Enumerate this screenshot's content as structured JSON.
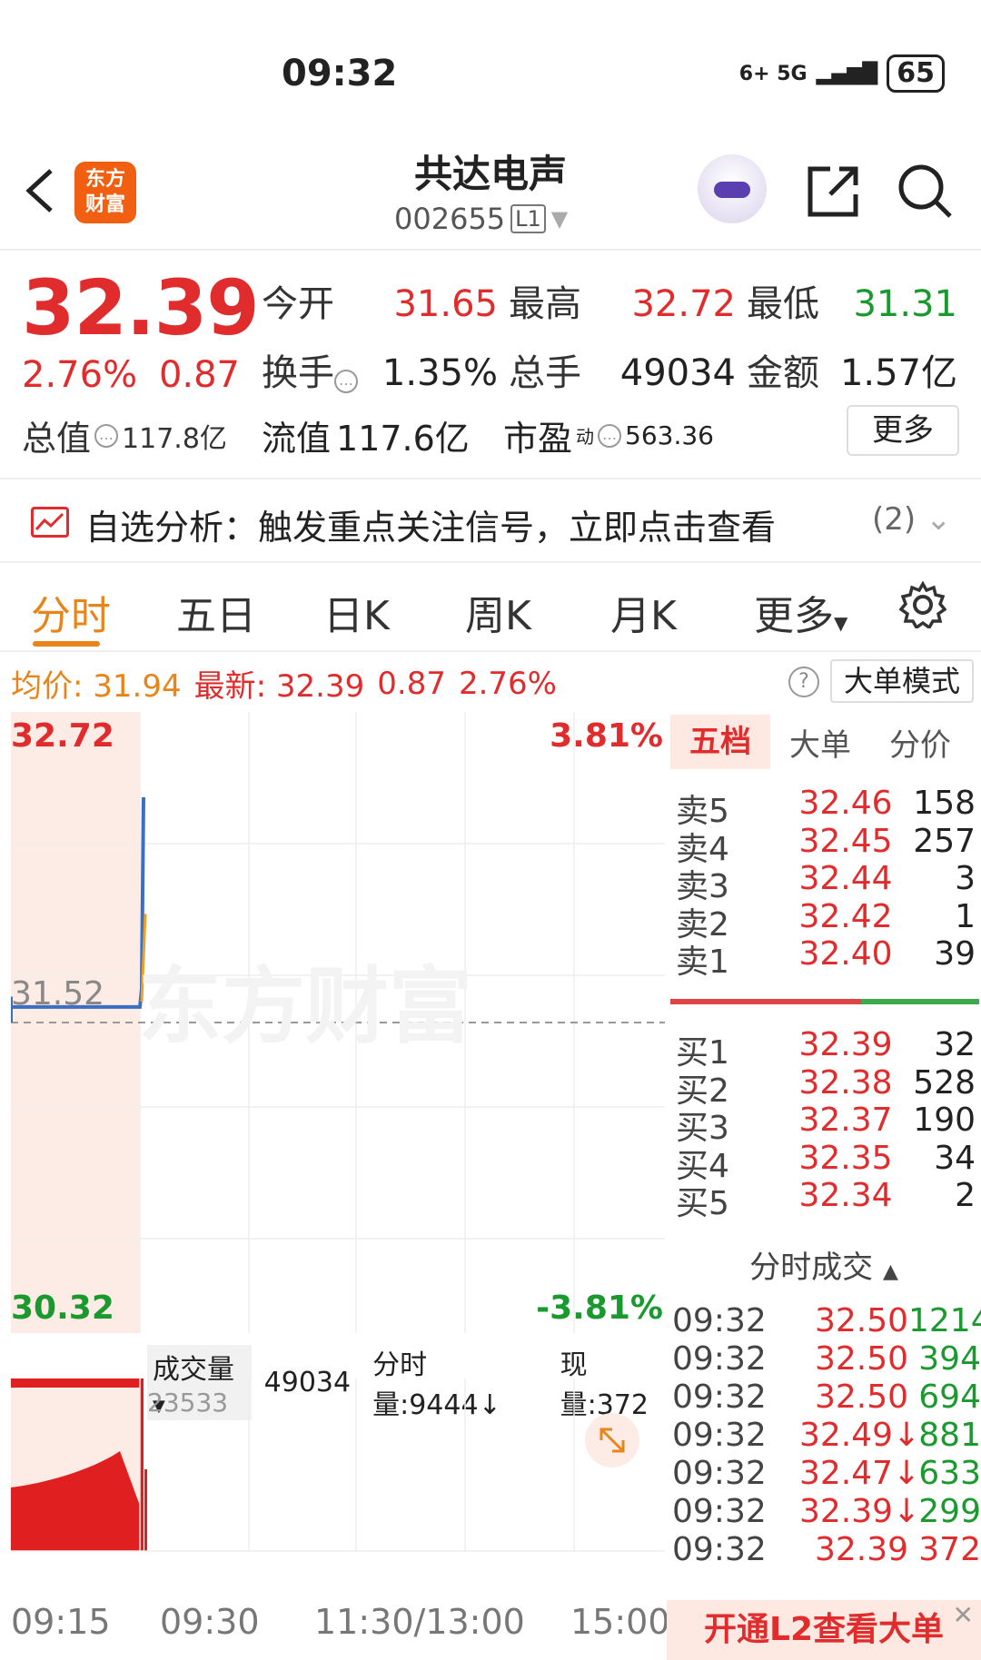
{
  "status_bar": {
    "time": "09:32",
    "network": "6+ 5G",
    "battery": "65"
  },
  "header": {
    "logo_line1": "东方",
    "logo_line2": "财富",
    "stock_name": "共达电声",
    "stock_code": "002655",
    "level_badge": "L1"
  },
  "quote": {
    "price": "32.39",
    "change_pct": "2.76%",
    "change_amt": "0.87",
    "open_label": "今开",
    "open": "31.65",
    "high_label": "最高",
    "high": "32.72",
    "low_label": "最低",
    "low": "31.31",
    "turnover_label": "换手",
    "turnover": "1.35%",
    "volume_label": "总手",
    "volume": "49034",
    "amount_label": "金额",
    "amount": "1.57亿",
    "total_cap_label": "总值",
    "total_cap": "117.8亿",
    "float_cap_label": "流值",
    "float_cap": "117.6亿",
    "pe_label": "市盈",
    "pe_sup": "动",
    "pe": "563.36",
    "more_label": "更多"
  },
  "signal": {
    "text": "自选分析：触发重点关注信号，立即点击查看",
    "count": "(2)"
  },
  "tabs": [
    "分时",
    "五日",
    "日K",
    "周K",
    "月K",
    "更多"
  ],
  "info_line": {
    "avg_label": "均价:",
    "avg": "31.94",
    "latest_label": "最新:",
    "latest": "32.39",
    "chg": "0.87",
    "pct": "2.76%",
    "big_order_mode": "大单模式"
  },
  "chart_labels": {
    "y_top": "32.72",
    "y_mid": "31.52",
    "y_bottom": "30.32",
    "pct_top": "3.81%",
    "pct_bottom": "-3.81%",
    "volume_selector": "成交量",
    "volume_total": "49034",
    "minute_vol": "分时量:9444↓",
    "now_vol": "现量:372",
    "vol_max": "23533",
    "watermark": "东方财富",
    "time_axis": [
      "09:15",
      "09:30",
      "11:30/13:00",
      "15:00"
    ]
  },
  "chart_data": {
    "type": "line",
    "x": [
      "09:15",
      "09:25",
      "09:30",
      "09:31",
      "09:32"
    ],
    "series": [
      {
        "values": [
          31.58,
          31.58,
          31.58,
          31.65,
          32.39
        ]
      }
    ],
    "ylim": [
      30.32,
      32.72
    ],
    "pre_close": 31.52
  },
  "order_book": {
    "tabs": [
      "五档",
      "大单",
      "分价"
    ],
    "asks": [
      {
        "label": "卖5",
        "price": "32.46",
        "vol": "158"
      },
      {
        "label": "卖4",
        "price": "32.45",
        "vol": "257"
      },
      {
        "label": "卖3",
        "price": "32.44",
        "vol": "3"
      },
      {
        "label": "卖2",
        "price": "32.42",
        "vol": "1"
      },
      {
        "label": "卖1",
        "price": "32.40",
        "vol": "39"
      }
    ],
    "bids": [
      {
        "label": "买1",
        "price": "32.39",
        "vol": "32"
      },
      {
        "label": "买2",
        "price": "32.38",
        "vol": "528"
      },
      {
        "label": "买3",
        "price": "32.37",
        "vol": "190"
      },
      {
        "label": "买4",
        "price": "32.35",
        "vol": "34"
      },
      {
        "label": "买5",
        "price": "32.34",
        "vol": "2"
      }
    ],
    "trades_title": "分时成交",
    "trades": [
      {
        "time": "09:32",
        "price": "32.50",
        "vol": "1214",
        "color": "#1a9a2e"
      },
      {
        "time": "09:32",
        "price": "32.50",
        "vol": "394",
        "color": "#1a9a2e"
      },
      {
        "time": "09:32",
        "price": "32.50",
        "vol": "694",
        "color": "#1a9a2e"
      },
      {
        "time": "09:32",
        "price": "32.49↓",
        "vol": "881",
        "color": "#1a9a2e"
      },
      {
        "time": "09:32",
        "price": "32.47↓",
        "vol": "633",
        "color": "#1a9a2e"
      },
      {
        "time": "09:32",
        "price": "32.39↓",
        "vol": "299",
        "color": "#1a9a2e"
      },
      {
        "time": "09:32",
        "price": "32.39",
        "vol": "372",
        "color": "#e02c2c"
      }
    ],
    "l2_banner": "开通L2查看大单"
  },
  "colors": {
    "up": "#e02c2c",
    "down": "#1a9a2e",
    "accent": "#e8851a",
    "price_line": "#3a6fc4",
    "avg_line": "#f0a020"
  }
}
